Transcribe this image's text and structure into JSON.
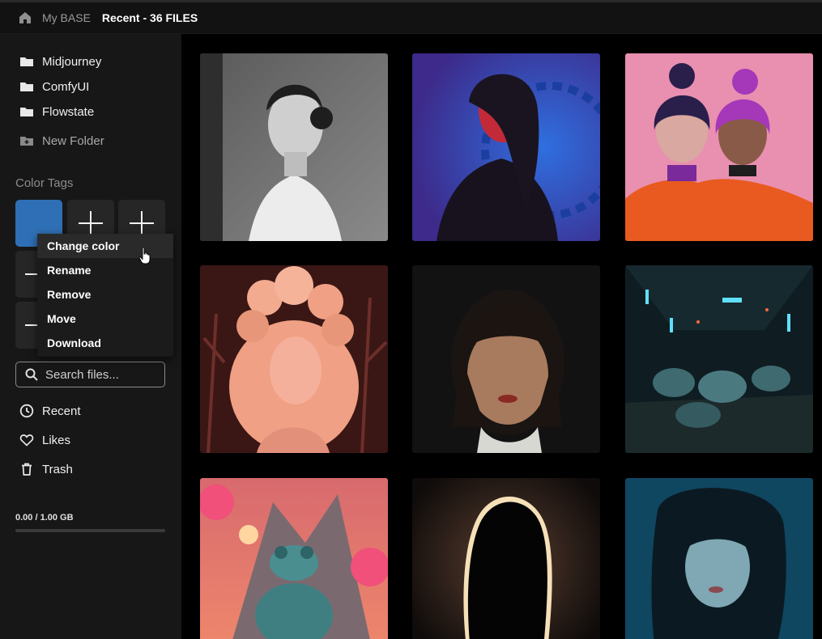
{
  "header": {
    "home_icon": "home-icon",
    "base_label": "My BASE",
    "title": "Recent - 36 FILES"
  },
  "sidebar": {
    "folders": [
      {
        "label": "Midjourney",
        "icon": "folder-icon"
      },
      {
        "label": "ComfyUI",
        "icon": "folder-icon"
      },
      {
        "label": "Flowstate",
        "icon": "folder-icon"
      }
    ],
    "new_folder_label": "New Folder",
    "color_tags_label": "Color Tags",
    "tag_color": "#2f6fb5",
    "context_menu": [
      "Change color",
      "Rename",
      "Remove",
      "Move",
      "Download"
    ],
    "search_placeholder": "Search files...",
    "nav": [
      {
        "label": "Recent",
        "icon": "clock-icon"
      },
      {
        "label": "Likes",
        "icon": "heart-icon"
      },
      {
        "label": "Trash",
        "icon": "trash-icon"
      }
    ],
    "storage_text": "0.00 / 1.00 GB",
    "storage_used_fraction": 0.0
  },
  "gallery": {
    "items": [
      {
        "subject": "woman-portrait-black-white"
      },
      {
        "subject": "woman-red-blue-light"
      },
      {
        "subject": "two-girls-pink-purple"
      },
      {
        "subject": "woman-peach-headdress"
      },
      {
        "subject": "woman-bangs-shadow"
      },
      {
        "subject": "frogs-sci-fi-tunnel"
      },
      {
        "subject": "frog-meditating-mountains"
      },
      {
        "subject": "woman-silhouette-backlit"
      },
      {
        "subject": "woman-teal-light"
      }
    ]
  }
}
